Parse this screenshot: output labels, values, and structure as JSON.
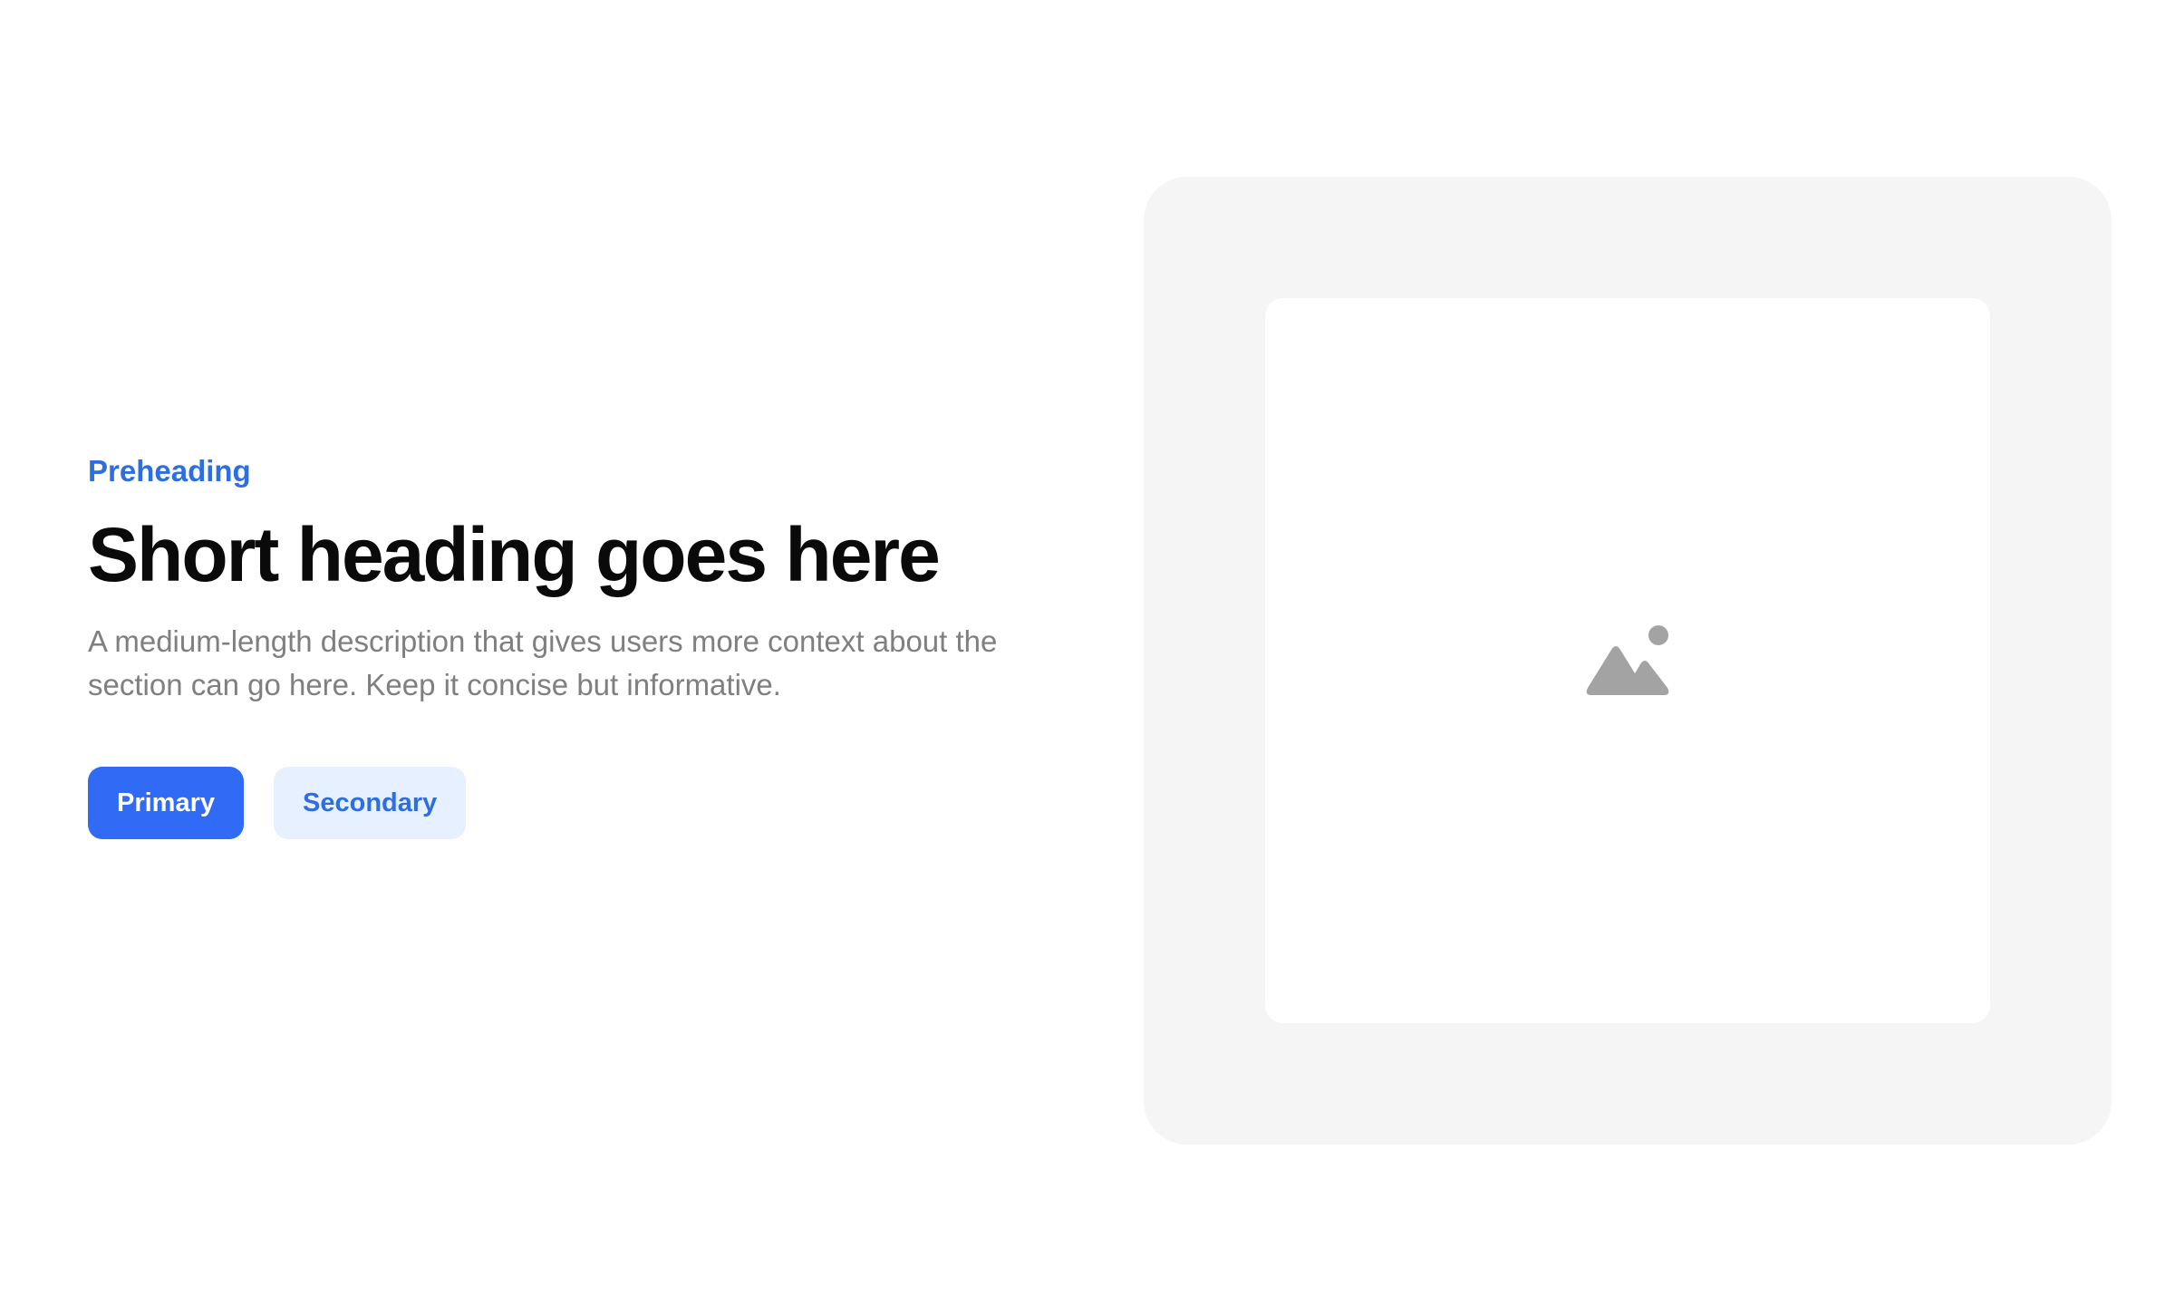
{
  "hero": {
    "preheading": "Preheading",
    "heading": "Short heading goes here",
    "description": "A medium-length description that gives users more context about the section can go here. Keep it concise but informative.",
    "primary_label": "Primary",
    "secondary_label": "Secondary"
  },
  "media": {
    "icon": "image-placeholder-icon"
  },
  "colors": {
    "accent": "#2d6ee0",
    "primary_button": "#2f6bf5",
    "secondary_button_bg": "#e7f0fe",
    "frame_bg": "#f5f5f5",
    "icon": "#a3a3a3"
  }
}
